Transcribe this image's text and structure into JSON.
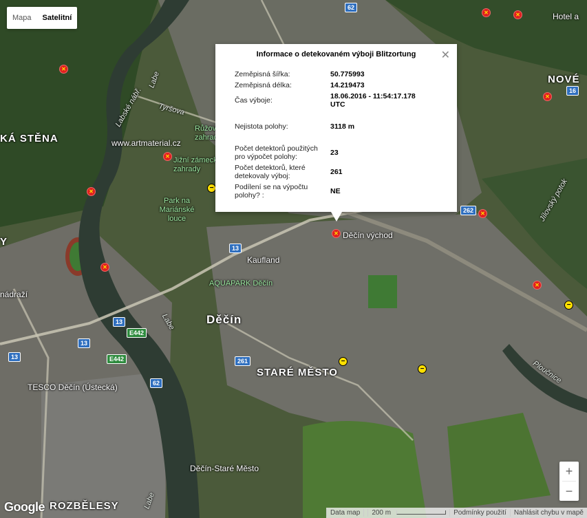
{
  "map_type": {
    "options": [
      "Mapa",
      "Satelitní"
    ],
    "active": "Satelitní"
  },
  "info_window": {
    "title": "Informace o detekovaném výboji Blitzortung",
    "close_icon": "close-icon",
    "rows": [
      {
        "label": "Zeměpisná šířka:",
        "value": "50.775993"
      },
      {
        "label": "Zeměpisná délka:",
        "value": "14.219473"
      },
      {
        "label": "Čas výboje:",
        "value": "18.06.2016 - 11:54:17.178 UTC"
      },
      {
        "label": "Nejistota polohy:",
        "value": "3118 m"
      },
      {
        "label": "Počet detektorů použitých pro výpočet polohy:",
        "value": "23"
      },
      {
        "label": "Počet detektorů, které detekovaly výboj:",
        "value": "261"
      },
      {
        "label": "Podílení se na výpočtu polohy? :",
        "value": "NE"
      }
    ]
  },
  "labels": {
    "tyrsova": "Tyršova",
    "labske": "Labské nábř.",
    "ruzova": "Růžová zahrada",
    "artmaterial": "www.artmaterial.cz",
    "jizni": "Jižní zámecká zahrady",
    "park": "Park na Mariánské louce",
    "kaufland": "Kaufland",
    "aquapark": "AQUAPARK Děčín",
    "decin": "Děčín",
    "stare_mesto": "STARÉ MĚSTO",
    "decin_vychod": "Děčín východ",
    "tesco": "TESCO Děčín (Ústecká)",
    "decin_stare": "Děčín-Staré Město",
    "ka_stena": "KÁ STĚNA",
    "nove": "NOVÉ",
    "rozbelesy": "ROZBĚLESY",
    "nadrazi": "nádraží",
    "hotel": "Hotel a",
    "labe1": "Labe",
    "labe2": "Labe",
    "labe3": "Labe",
    "ploucnice": "Ploučnice",
    "jilovsky": "Jílovský potok",
    "y": "Y"
  },
  "shields": [
    "62",
    "13",
    "13",
    "13",
    "13",
    "E442",
    "E442",
    "62",
    "261",
    "262",
    "16"
  ],
  "strike_colors": {
    "red": "#e02020",
    "yellow": "#ffe000"
  },
  "zoom": {
    "in": "+",
    "out": "−"
  },
  "attribution": {
    "logo": "Google",
    "items": [
      "Data map",
      "200 m",
      "Podmínky použití",
      "Nahlásit chybu v mapě"
    ]
  }
}
